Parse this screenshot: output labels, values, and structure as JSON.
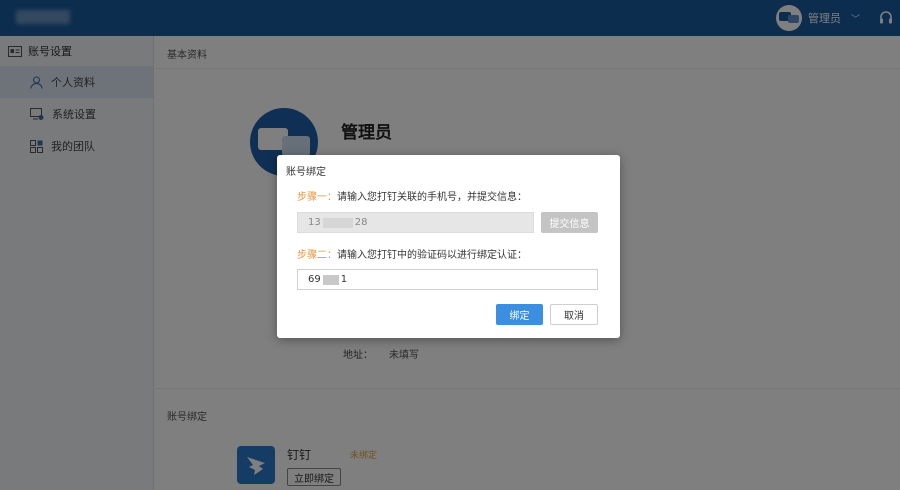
{
  "header": {
    "user_name": "管理员",
    "dropdown_glyph": "﹀"
  },
  "sidebar": {
    "title": "账号设置",
    "items": [
      {
        "label": "个人资料",
        "icon": "user-icon"
      },
      {
        "label": "系统设置",
        "icon": "monitor-gear-icon"
      },
      {
        "label": "我的团队",
        "icon": "team-grid-icon"
      }
    ]
  },
  "main": {
    "section_basic": "基本资料",
    "profile_name": "管理员",
    "address_label": "地址：",
    "address_value": "未填写",
    "section_binding": "账号绑定",
    "dingtalk_name": "钉钉",
    "dingtalk_status": "未绑定",
    "bind_now_label": "立即绑定"
  },
  "modal": {
    "title": "账号绑定",
    "step1_label": "步骤一：",
    "step1_text": "请输入您打钉关联的手机号，并提交信息：",
    "phone_prefix": "13",
    "phone_suffix": "28",
    "submit_label": "提交信息",
    "step2_label": "步骤二：",
    "step2_text": "请输入您打钉中的验证码以进行绑定认证：",
    "code_prefix": "69",
    "code_suffix": "1",
    "bind_label": "绑定",
    "cancel_label": "取消"
  },
  "colors": {
    "topbar": "#1a5a9e",
    "accent_orange": "#e8963d",
    "primary_button": "#3c8ee0"
  }
}
